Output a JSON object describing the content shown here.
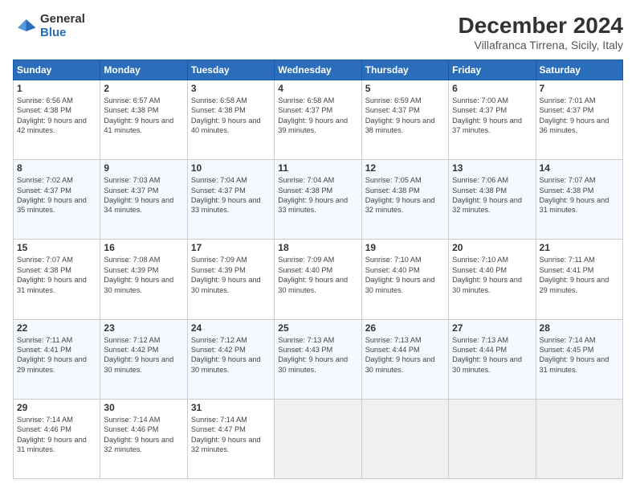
{
  "logo": {
    "general": "General",
    "blue": "Blue"
  },
  "title": "December 2024",
  "subtitle": "Villafranca Tirrena, Sicily, Italy",
  "days_header": [
    "Sunday",
    "Monday",
    "Tuesday",
    "Wednesday",
    "Thursday",
    "Friday",
    "Saturday"
  ],
  "weeks": [
    [
      {
        "day": "1",
        "sunrise": "6:56 AM",
        "sunset": "4:38 PM",
        "daylight": "9 hours and 42 minutes."
      },
      {
        "day": "2",
        "sunrise": "6:57 AM",
        "sunset": "4:38 PM",
        "daylight": "9 hours and 41 minutes."
      },
      {
        "day": "3",
        "sunrise": "6:58 AM",
        "sunset": "4:38 PM",
        "daylight": "9 hours and 40 minutes."
      },
      {
        "day": "4",
        "sunrise": "6:58 AM",
        "sunset": "4:37 PM",
        "daylight": "9 hours and 39 minutes."
      },
      {
        "day": "5",
        "sunrise": "6:59 AM",
        "sunset": "4:37 PM",
        "daylight": "9 hours and 38 minutes."
      },
      {
        "day": "6",
        "sunrise": "7:00 AM",
        "sunset": "4:37 PM",
        "daylight": "9 hours and 37 minutes."
      },
      {
        "day": "7",
        "sunrise": "7:01 AM",
        "sunset": "4:37 PM",
        "daylight": "9 hours and 36 minutes."
      }
    ],
    [
      {
        "day": "8",
        "sunrise": "7:02 AM",
        "sunset": "4:37 PM",
        "daylight": "9 hours and 35 minutes."
      },
      {
        "day": "9",
        "sunrise": "7:03 AM",
        "sunset": "4:37 PM",
        "daylight": "9 hours and 34 minutes."
      },
      {
        "day": "10",
        "sunrise": "7:04 AM",
        "sunset": "4:37 PM",
        "daylight": "9 hours and 33 minutes."
      },
      {
        "day": "11",
        "sunrise": "7:04 AM",
        "sunset": "4:38 PM",
        "daylight": "9 hours and 33 minutes."
      },
      {
        "day": "12",
        "sunrise": "7:05 AM",
        "sunset": "4:38 PM",
        "daylight": "9 hours and 32 minutes."
      },
      {
        "day": "13",
        "sunrise": "7:06 AM",
        "sunset": "4:38 PM",
        "daylight": "9 hours and 32 minutes."
      },
      {
        "day": "14",
        "sunrise": "7:07 AM",
        "sunset": "4:38 PM",
        "daylight": "9 hours and 31 minutes."
      }
    ],
    [
      {
        "day": "15",
        "sunrise": "7:07 AM",
        "sunset": "4:38 PM",
        "daylight": "9 hours and 31 minutes."
      },
      {
        "day": "16",
        "sunrise": "7:08 AM",
        "sunset": "4:39 PM",
        "daylight": "9 hours and 30 minutes."
      },
      {
        "day": "17",
        "sunrise": "7:09 AM",
        "sunset": "4:39 PM",
        "daylight": "9 hours and 30 minutes."
      },
      {
        "day": "18",
        "sunrise": "7:09 AM",
        "sunset": "4:40 PM",
        "daylight": "9 hours and 30 minutes."
      },
      {
        "day": "19",
        "sunrise": "7:10 AM",
        "sunset": "4:40 PM",
        "daylight": "9 hours and 30 minutes."
      },
      {
        "day": "20",
        "sunrise": "7:10 AM",
        "sunset": "4:40 PM",
        "daylight": "9 hours and 30 minutes."
      },
      {
        "day": "21",
        "sunrise": "7:11 AM",
        "sunset": "4:41 PM",
        "daylight": "9 hours and 29 minutes."
      }
    ],
    [
      {
        "day": "22",
        "sunrise": "7:11 AM",
        "sunset": "4:41 PM",
        "daylight": "9 hours and 29 minutes."
      },
      {
        "day": "23",
        "sunrise": "7:12 AM",
        "sunset": "4:42 PM",
        "daylight": "9 hours and 30 minutes."
      },
      {
        "day": "24",
        "sunrise": "7:12 AM",
        "sunset": "4:42 PM",
        "daylight": "9 hours and 30 minutes."
      },
      {
        "day": "25",
        "sunrise": "7:13 AM",
        "sunset": "4:43 PM",
        "daylight": "9 hours and 30 minutes."
      },
      {
        "day": "26",
        "sunrise": "7:13 AM",
        "sunset": "4:44 PM",
        "daylight": "9 hours and 30 minutes."
      },
      {
        "day": "27",
        "sunrise": "7:13 AM",
        "sunset": "4:44 PM",
        "daylight": "9 hours and 30 minutes."
      },
      {
        "day": "28",
        "sunrise": "7:14 AM",
        "sunset": "4:45 PM",
        "daylight": "9 hours and 31 minutes."
      }
    ],
    [
      {
        "day": "29",
        "sunrise": "7:14 AM",
        "sunset": "4:46 PM",
        "daylight": "9 hours and 31 minutes."
      },
      {
        "day": "30",
        "sunrise": "7:14 AM",
        "sunset": "4:46 PM",
        "daylight": "9 hours and 32 minutes."
      },
      {
        "day": "31",
        "sunrise": "7:14 AM",
        "sunset": "4:47 PM",
        "daylight": "9 hours and 32 minutes."
      },
      null,
      null,
      null,
      null
    ]
  ]
}
